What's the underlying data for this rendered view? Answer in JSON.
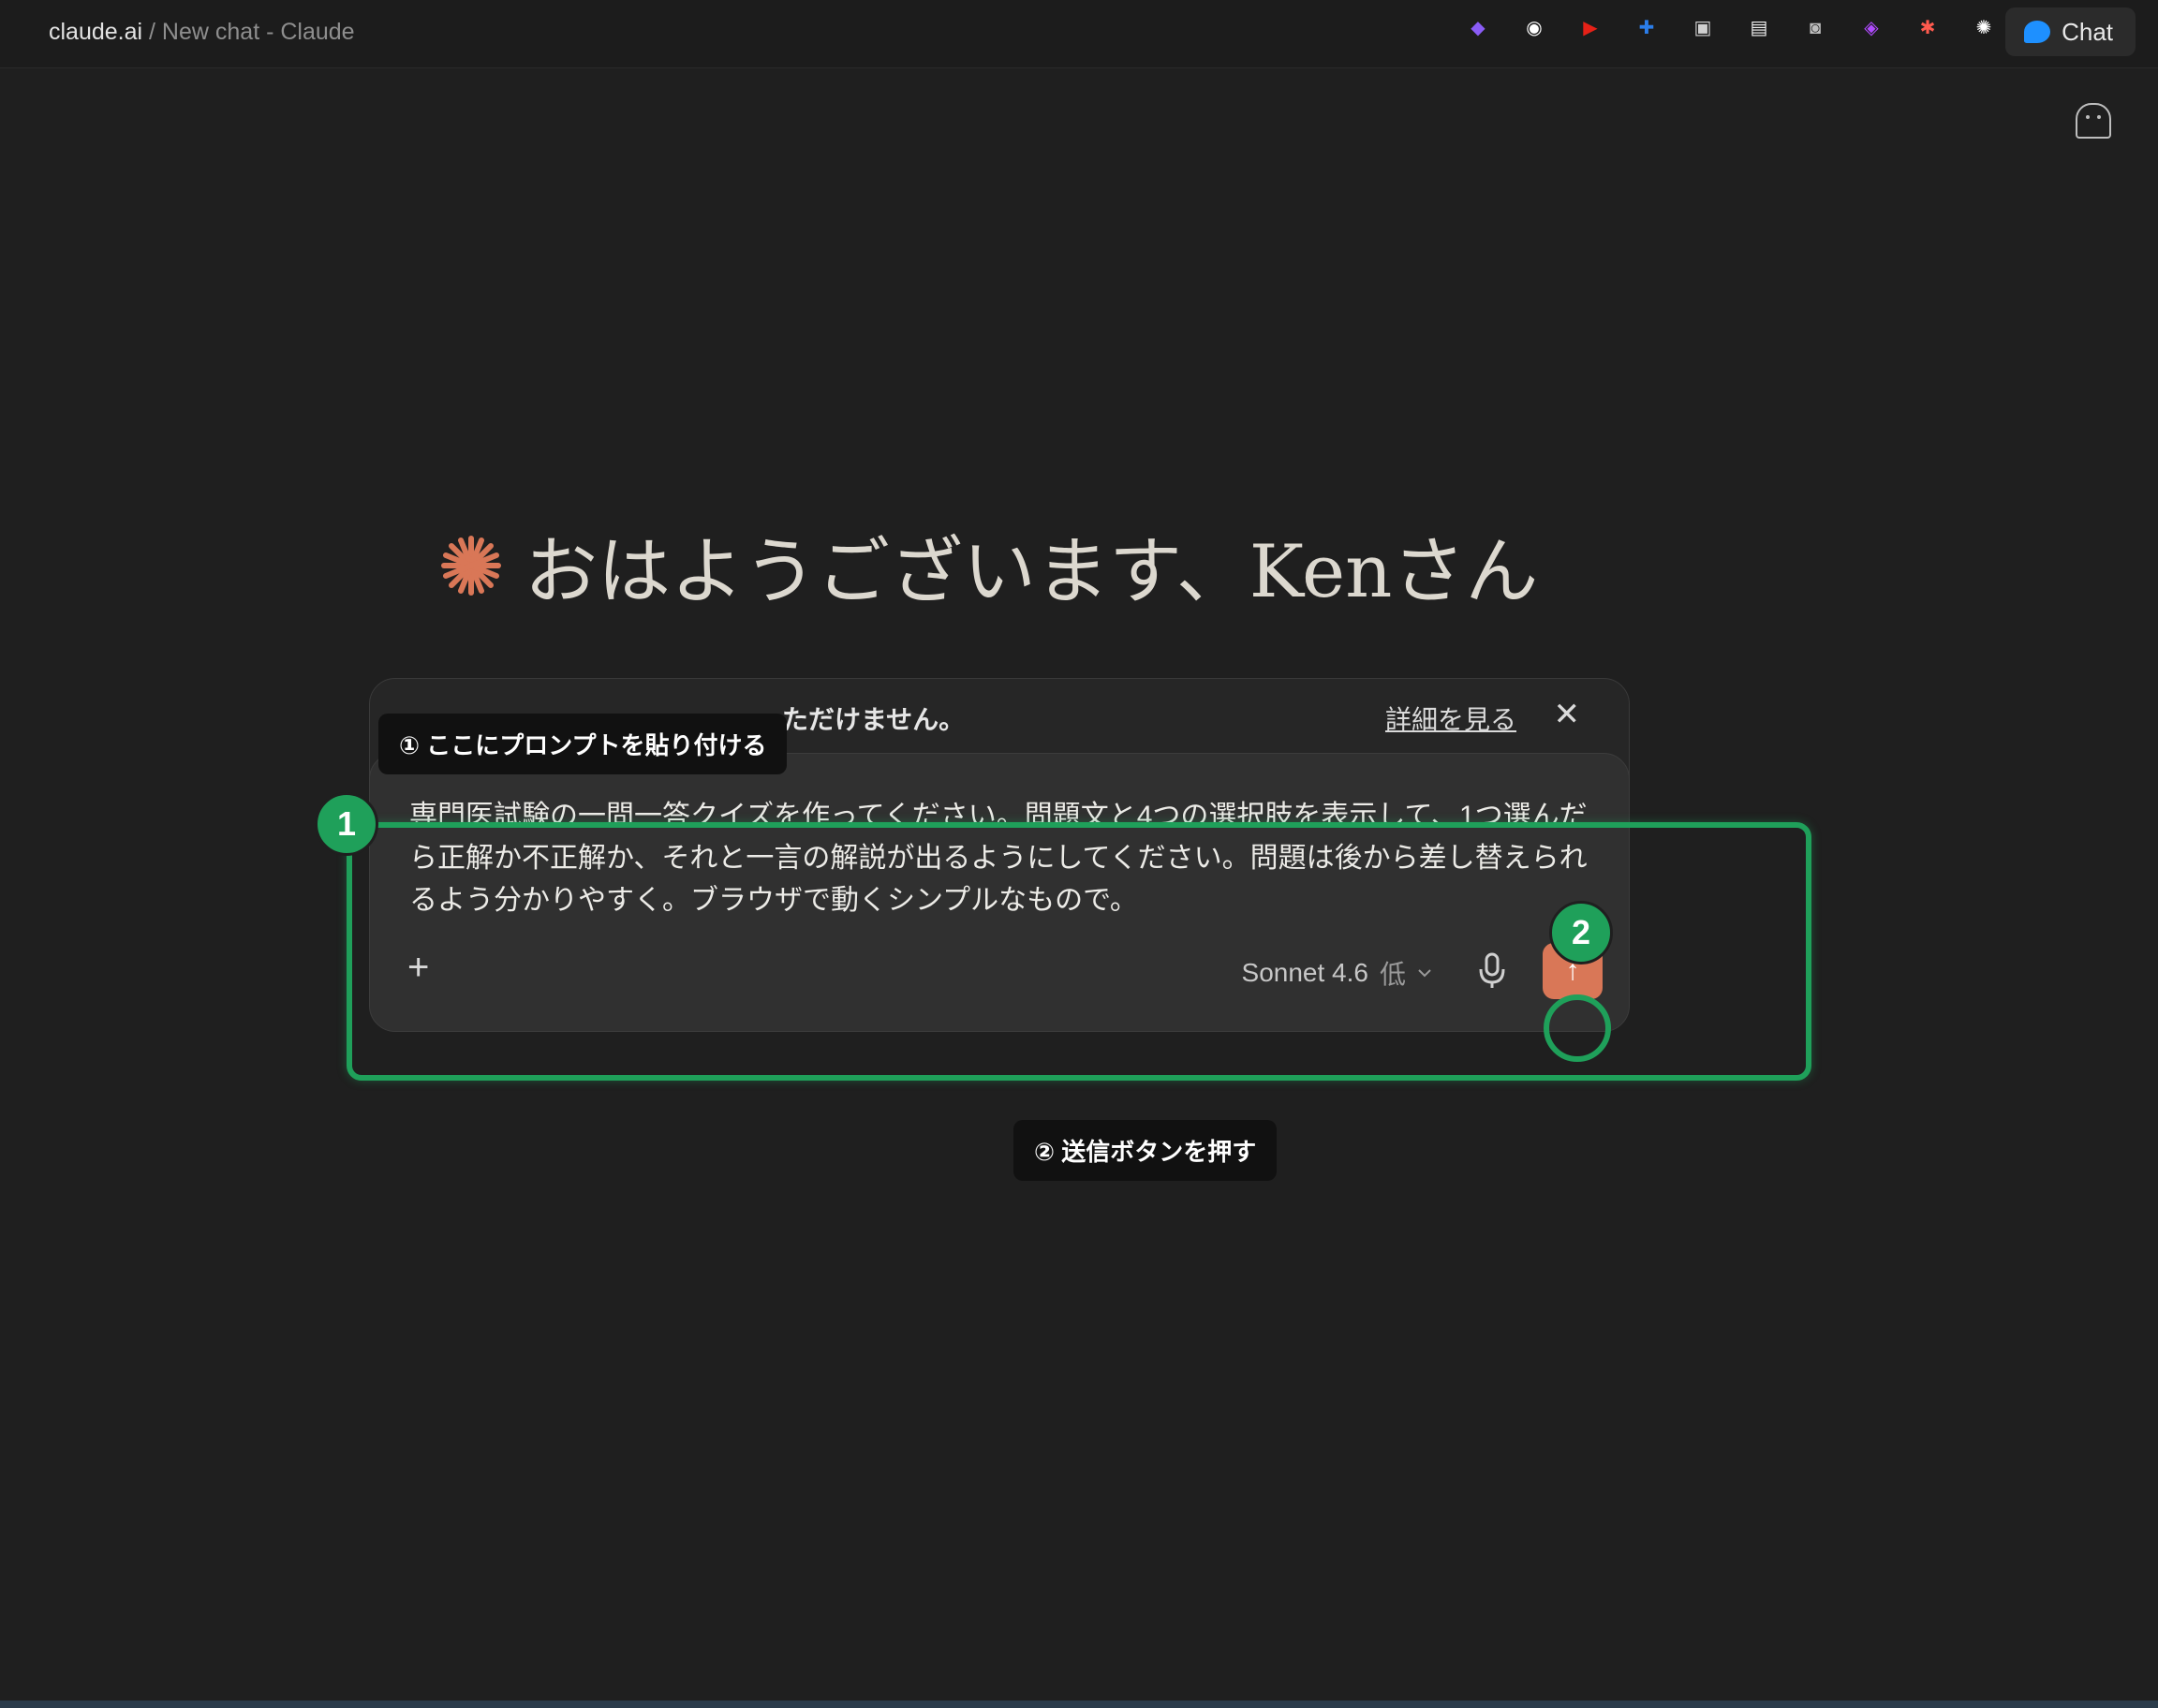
{
  "browser": {
    "host": "claude.ai",
    "separator": " / ",
    "title": "New chat - Claude",
    "chat_button_label": "Chat",
    "extensions": [
      {
        "icon": "obsidian-icon",
        "glyph": "◆",
        "color": "#8a5cf6"
      },
      {
        "icon": "extension-icon-2",
        "glyph": "◉",
        "color": "#ffffff"
      },
      {
        "icon": "youtube-icon",
        "glyph": "▶",
        "color": "#e62117"
      },
      {
        "icon": "extension-icon-4",
        "glyph": "✚",
        "color": "#2b7de9"
      },
      {
        "icon": "monitor-icon",
        "glyph": "▣",
        "color": "#d0d0d0"
      },
      {
        "icon": "extension-icon-6",
        "glyph": "▤",
        "color": "#f2f2f2"
      },
      {
        "icon": "camera-icon",
        "glyph": "◙",
        "color": "#bdbdbd"
      },
      {
        "icon": "extension-icon-8",
        "glyph": "◈",
        "color": "#b04bff"
      },
      {
        "icon": "extension-icon-9",
        "glyph": "✱",
        "color": "#ff5a4e"
      },
      {
        "icon": "chatgpt-icon",
        "glyph": "✺",
        "color": "#ffffff"
      }
    ]
  },
  "main": {
    "greeting": "おはようございます、Kenさん",
    "notice": {
      "text": "ただけません。",
      "link": "詳細を見る",
      "close": "✕"
    },
    "composer": {
      "prompt": "専門医試験の一問一答クイズを作ってください。問題文と4つの選択肢を表示して、1つ選んだら正解か不正解か、それと一言の解説が出るようにしてください。問題は後から差し替えられるよう分かりやすく。ブラウザで動くシンプルなもので。",
      "add_label": "+",
      "model_name": "Sonnet 4.6",
      "model_level": "低",
      "send_label": "↑"
    }
  },
  "annotations": {
    "step1_badge": "1",
    "step1_tip": "① ここにプロンプトを貼り付ける",
    "step2_badge": "2",
    "step2_tip": "② 送信ボタンを押す",
    "highlight_color": "#1fa05a"
  },
  "colors": {
    "accent": "#d97757",
    "background": "#1f1f1f"
  }
}
